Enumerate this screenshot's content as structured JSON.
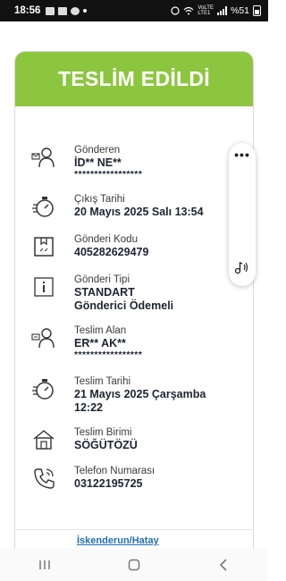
{
  "status_bar": {
    "time": "18:56",
    "battery": "%51",
    "network": "VoLTE LTE1"
  },
  "card": {
    "title": "TESLİM EDİLDİ",
    "accent_color": "#8cc63f",
    "rows": [
      {
        "icon": "sender-person-icon",
        "label": "Gönderen",
        "value": "İD** NE**",
        "masked": "*****************"
      },
      {
        "icon": "stopwatch-icon",
        "label": "Çıkış Tarihi",
        "value": "20 Mayıs 2025 Salı 13:54"
      },
      {
        "icon": "package-box-icon",
        "label": "Gönderi Kodu",
        "value": "405282629479"
      },
      {
        "icon": "info-icon",
        "label": "Gönderi Tipi",
        "value": "STANDART",
        "value2": "Gönderici Ödemeli"
      },
      {
        "icon": "receiver-person-icon",
        "label": "Teslim Alan",
        "value": "ER** AK**",
        "masked": "*****************"
      },
      {
        "icon": "stopwatch-icon",
        "label": "Teslim Tarihi",
        "value": "21 Mayıs 2025 Çarşamba",
        "value2": "12:22"
      },
      {
        "icon": "branch-house-icon",
        "label": "Teslim Birimi",
        "value": "SÖĞÜTÖZÜ"
      },
      {
        "icon": "phone-icon",
        "label": "Telefon Numarası",
        "value": "03122195725"
      }
    ]
  },
  "footer_link": "İskenderun/Hatay",
  "floating_panel": {
    "more": "•••"
  }
}
